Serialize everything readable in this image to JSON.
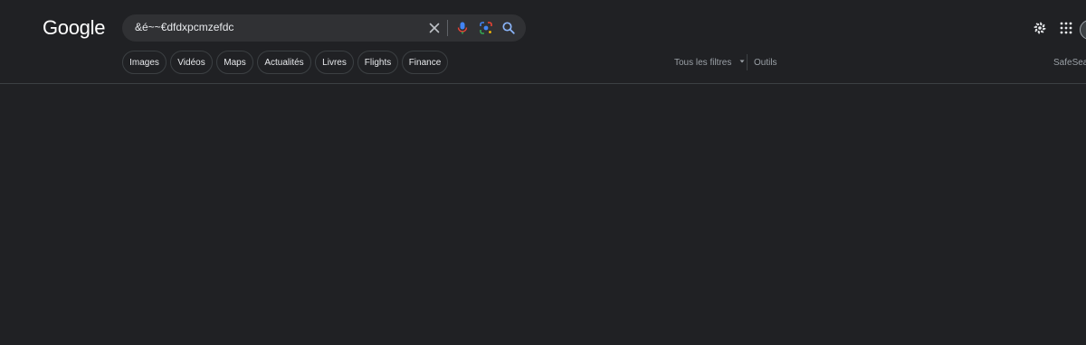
{
  "logo": {
    "text": "Google"
  },
  "search": {
    "query": "&é~~€dfdxpcmzefdc",
    "clear_icon": "close-icon",
    "voice_icon": "microphone-icon",
    "lens_icon": "lens-icon",
    "search_icon": "search-icon"
  },
  "header": {
    "settings_icon": "gear-icon",
    "apps_icon": "apps-grid-icon"
  },
  "chips": [
    {
      "label": "Images"
    },
    {
      "label": "Vidéos"
    },
    {
      "label": "Maps"
    },
    {
      "label": "Actualités"
    },
    {
      "label": "Livres"
    },
    {
      "label": "Flights"
    },
    {
      "label": "Finance"
    }
  ],
  "filters": {
    "all_filters_label": "Tous les filtres",
    "tools_label": "Outils",
    "safesearch_label": "SafeSearch"
  },
  "colors": {
    "background": "#202124",
    "searchbox": "#303134",
    "mic_blue": "#4285f4",
    "mic_red": "#ea4335"
  }
}
